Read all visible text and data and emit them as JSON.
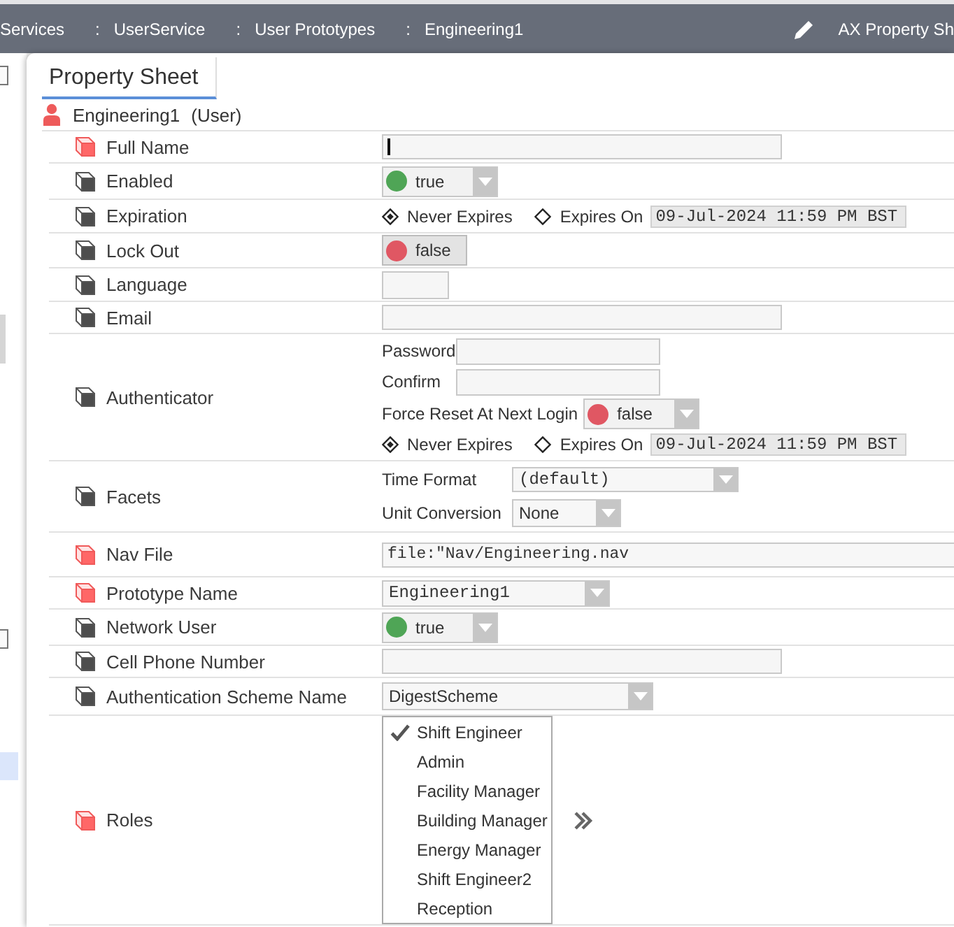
{
  "toolbar": {
    "breadcrumb": [
      {
        "label": "Services"
      },
      {
        "separator": ":",
        "label": "UserService"
      },
      {
        "separator": ":",
        "label": "User Prototypes"
      },
      {
        "separator": ":",
        "label": "Engineering1"
      }
    ],
    "view_button": {
      "label": "AX Property Sh"
    }
  },
  "tabs": [
    {
      "label": "Property Sheet",
      "selected": true
    }
  ],
  "object": {
    "name": "Engineering1",
    "type": "(User)"
  },
  "properties": [
    {
      "label": "Full Name",
      "flagged": true,
      "kind": "text",
      "focused": true
    },
    {
      "label": "Enabled",
      "flagged": false,
      "kind": "bool_select",
      "value": "true",
      "on": true
    },
    {
      "label": "Expiration",
      "flagged": false,
      "kind": "expiration",
      "options": [
        {
          "label": "Never Expires",
          "selected": true
        },
        {
          "label": "Expires On",
          "selected": false
        }
      ],
      "date": "09-Jul-2024 11:59 PM BST"
    },
    {
      "label": "Lock Out",
      "flagged": false,
      "kind": "bool_toggle",
      "value": "false",
      "on": false
    },
    {
      "label": "Language",
      "flagged": false,
      "kind": "short_text"
    },
    {
      "label": "Email",
      "flagged": false,
      "kind": "text"
    },
    {
      "label": "Authenticator",
      "flagged": false,
      "kind": "group",
      "fields": [
        {
          "label": "Password",
          "kind": "password"
        },
        {
          "label": "Confirm",
          "kind": "password"
        },
        {
          "label": "Force Reset At Next Login",
          "kind": "bool_select",
          "value": "false",
          "on": false
        },
        {
          "kind": "expiration",
          "options": [
            {
              "label": "Never Expires",
              "selected": true
            },
            {
              "label": "Expires On",
              "selected": false
            }
          ],
          "date": "09-Jul-2024 11:59 PM BST"
        }
      ]
    },
    {
      "label": "Facets",
      "flagged": false,
      "kind": "group",
      "fields": [
        {
          "label": "Time Format",
          "kind": "mono_select",
          "value": "(default)"
        },
        {
          "label": "Unit Conversion",
          "kind": "select",
          "value": "None"
        }
      ]
    },
    {
      "label": "Nav File",
      "flagged": true,
      "kind": "path",
      "value": "file:\"Nav/Engineering.nav"
    },
    {
      "label": "Prototype Name",
      "flagged": true,
      "kind": "mono_select",
      "value": "Engineering1"
    },
    {
      "label": "Network User",
      "flagged": false,
      "kind": "bool_select",
      "value": "true",
      "on": true
    },
    {
      "label": "Cell Phone Number",
      "flagged": false,
      "kind": "text"
    },
    {
      "label": "Authentication Scheme Name",
      "flagged": false,
      "kind": "select",
      "value": "DigestScheme"
    },
    {
      "label": "Roles",
      "flagged": true,
      "kind": "checklist",
      "items": [
        {
          "label": "Shift Engineer",
          "checked": true
        },
        {
          "label": "Admin",
          "checked": false
        },
        {
          "label": "Facility Manager",
          "checked": false
        },
        {
          "label": "Building Manager",
          "checked": false
        },
        {
          "label": "Energy Manager",
          "checked": false
        },
        {
          "label": "Shift Engineer2",
          "checked": false
        },
        {
          "label": "Reception",
          "checked": false
        }
      ]
    }
  ]
}
